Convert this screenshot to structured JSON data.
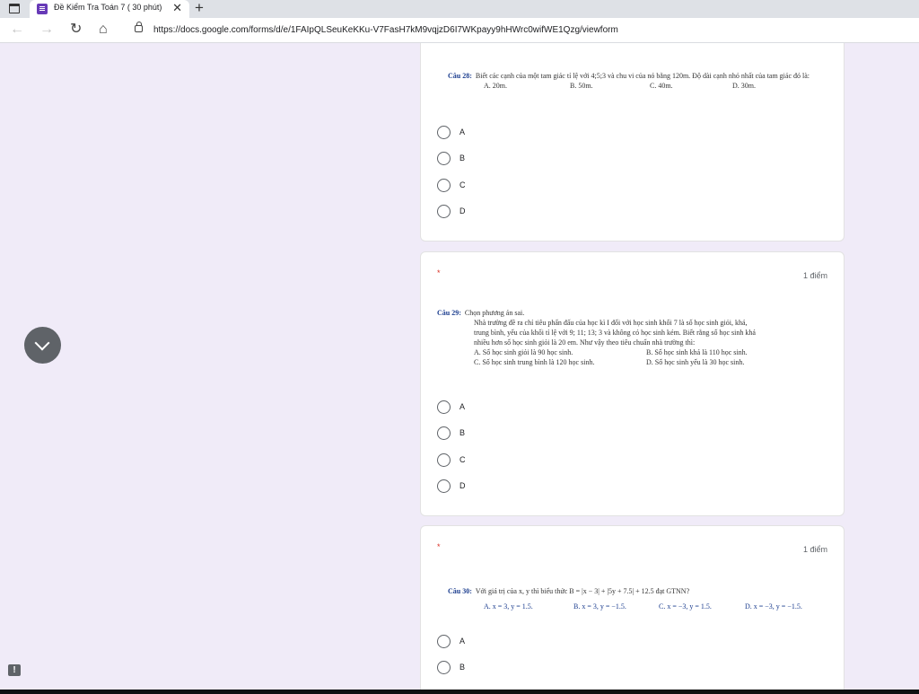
{
  "browser": {
    "tab_title": "Đề Kiểm Tra Toán 7 ( 30 phút)",
    "tab_close": "✕",
    "new_tab": "+",
    "url": "https://docs.google.com/forms/d/e/1FAIpQLSeuKeKKu-V7FasH7kM9vqjzD6I7WKpayy9hHWrc0wifWE1Qzg/viewform"
  },
  "questions": [
    {
      "number": "Câu 28:",
      "text": "Biết các cạnh của một tam giác tỉ lệ với 4;5;3 và chu vi của nó bằng 120m. Độ dài cạnh nhỏ nhất của tam giác đó là:",
      "choices": [
        "A. 20m.",
        "B. 50m.",
        "C. 40m.",
        "D. 30m."
      ],
      "options": [
        "A",
        "B",
        "C",
        "D"
      ]
    },
    {
      "required": "*",
      "points": "1 điểm",
      "number": "Câu 29:",
      "lead": "Chọn phương án sai.",
      "text_lines": [
        "Nhà trường đề ra chỉ tiêu phấn đấu của học kì I đối với học sinh khối 7 là số học sinh giỏi, khá,",
        "trung bình, yếu của khối tỉ lệ với 9; 11; 13; 3 và không có học sinh kém. Biết rằng số học sinh khá",
        "nhiều hơn số học sinh giỏi là 20 em. Như vậy theo tiêu chuẩn nhà trường thì:"
      ],
      "choices": [
        "A. Số học sinh giỏi là 90 học sinh.",
        "B. Số học sinh khá là 110 học sinh.",
        "C. Số học sinh trung bình là 120 học sinh.",
        "D. Số học sinh yếu là 30 học sinh."
      ],
      "options": [
        "A",
        "B",
        "C",
        "D"
      ]
    },
    {
      "required": "*",
      "points": "1 điểm",
      "number": "Câu 30:",
      "text": "Với giá trị của x, y thì biểu thức B = |x − 3| + |5y + 7.5| + 12.5 đạt GTNN?",
      "choices": [
        "A. x = 3, y = 1.5.",
        "B. x = 3, y = −1.5.",
        "C. x = −3, y = 1.5.",
        "D. x = −3, y = −1.5."
      ],
      "options": [
        "A",
        "B"
      ]
    }
  ],
  "feedback_label": "!"
}
